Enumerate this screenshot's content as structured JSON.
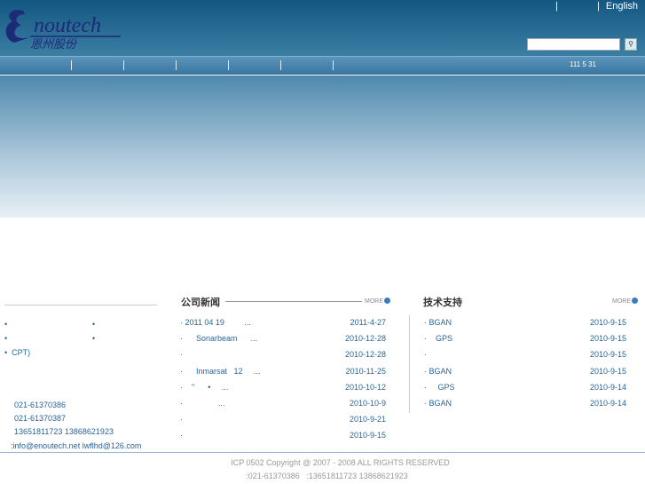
{
  "header": {
    "logo_text": "Enoutech",
    "logo_cn": "恩州股份",
    "language_link": "English",
    "search_placeholder": "",
    "search_icon": "search-icon"
  },
  "nav": {
    "date": "111 5 31"
  },
  "left": {
    "items": [
      "•",
      "•",
      "•",
      "•",
      "•  CPT)"
    ],
    "contacts": [
      "021-61370386",
      "021-61370387",
      "13651811723 13868621923",
      ":info@enoutech.net  lwflhd@126.com"
    ]
  },
  "news": {
    "title": "公司新闻",
    "more": "MORE",
    "items": [
      {
        "title": "· 2011 04 19         ...",
        "date": "2011-4-27"
      },
      {
        "title": "·      Sonarbeam      ...",
        "date": "2010-12-28"
      },
      {
        "title": "·",
        "date": "2010-12-28"
      },
      {
        "title": "·      Inmarsat   12     ...",
        "date": "2010-11-25"
      },
      {
        "title": "·    \"      •     ...",
        "date": "2010-10-12"
      },
      {
        "title": "·                ...",
        "date": "2010-10-9"
      },
      {
        "title": "·",
        "date": "2010-9-21"
      },
      {
        "title": "·",
        "date": "2010-9-15"
      }
    ]
  },
  "support": {
    "title": "技术支持",
    "more": "MORE",
    "items": [
      {
        "title": "· BGAN",
        "date": "2010-9-15"
      },
      {
        "title": "·    GPS",
        "date": "2010-9-15"
      },
      {
        "title": "·",
        "date": "2010-9-15"
      },
      {
        "title": "· BGAN",
        "date": "2010-9-15"
      },
      {
        "title": "·     GPS",
        "date": "2010-9-14"
      },
      {
        "title": "· BGAN",
        "date": "2010-9-14"
      }
    ]
  },
  "footer": {
    "copyright": "ICP 0502 Copyright @ 2007 - 2008 ALL RIGHTS RESERVED",
    "phones": ":021-61370386   :13651811723 13868621923"
  }
}
